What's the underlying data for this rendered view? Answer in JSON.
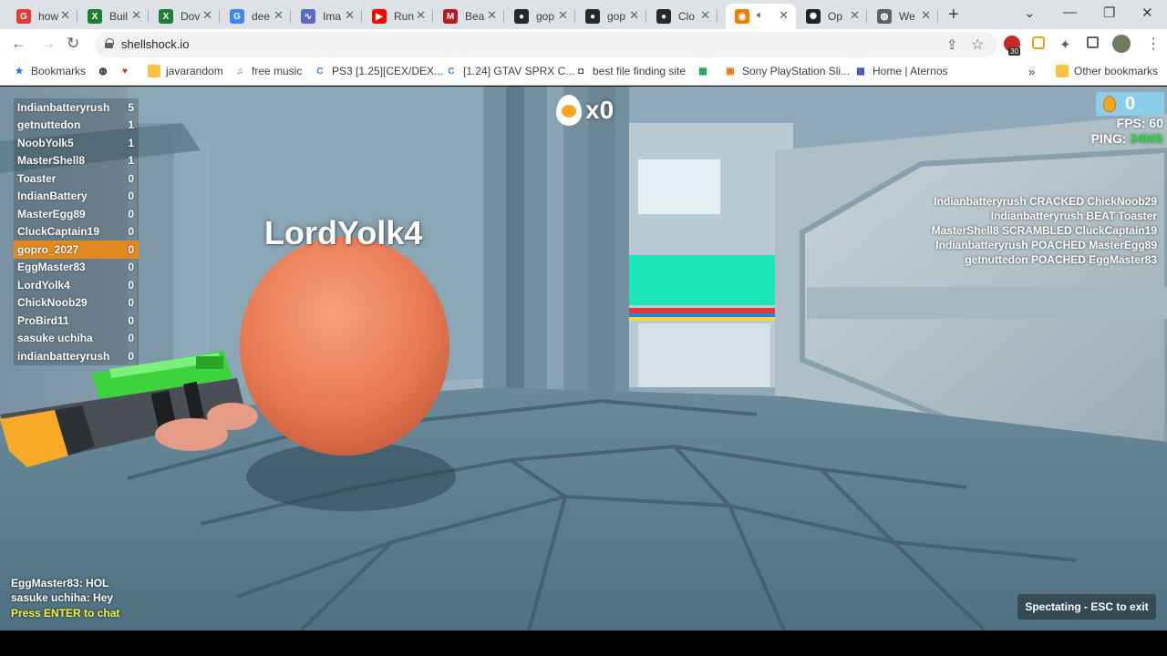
{
  "browser": {
    "tabs": [
      {
        "title": "how",
        "icon": "google-icon",
        "color": "#e53935"
      },
      {
        "title": "Buil",
        "icon": "excel-icon",
        "color": "#1e7e34"
      },
      {
        "title": "Dov",
        "icon": "excel-icon",
        "color": "#1e7e34"
      },
      {
        "title": "dee",
        "icon": "google-icon",
        "color": "#4285f4"
      },
      {
        "title": "Ima",
        "icon": "chart-icon",
        "color": "#5c6bc0"
      },
      {
        "title": "Run",
        "icon": "youtube-icon",
        "color": "#ff0000"
      },
      {
        "title": "Bea",
        "icon": "m-icon",
        "color": "#b71c1c"
      },
      {
        "title": "gop",
        "icon": "github-icon",
        "color": "#24292e"
      },
      {
        "title": "gop",
        "icon": "github-icon",
        "color": "#24292e"
      },
      {
        "title": "Clo",
        "icon": "github-icon",
        "color": "#24292e"
      },
      {
        "title": "",
        "icon": "shellshock-icon",
        "color": "#f57c00",
        "active": true
      },
      {
        "title": "Op",
        "icon": "openai-icon",
        "color": "#202124"
      },
      {
        "title": "We",
        "icon": "globe-icon",
        "color": "#5f6368"
      }
    ],
    "url": "shellshock.io",
    "extension_badge": "30"
  },
  "bookmarks": [
    {
      "label": "Bookmarks",
      "icon": "star-icon"
    },
    {
      "label": "",
      "icon": "globe-icon"
    },
    {
      "label": "",
      "icon": "heart-icon"
    },
    {
      "label": "javarandom",
      "icon": "folder-icon"
    },
    {
      "label": "free music",
      "icon": "music-icon"
    },
    {
      "label": "PS3 [1.25][CEX/DEX...",
      "icon": "c-icon"
    },
    {
      "label": "[1.24] GTAV SPRX C...",
      "icon": "c-icon"
    },
    {
      "label": "best file finding site",
      "icon": "robot-icon"
    },
    {
      "label": "",
      "icon": "sheet-icon"
    },
    {
      "label": "Sony PlayStation Sli...",
      "icon": "gift-icon"
    },
    {
      "label": "Home | Aternos",
      "icon": "aternos-icon"
    },
    {
      "label": "Other bookmarks",
      "icon": "folder-icon"
    }
  ],
  "game": {
    "scoreboard": [
      {
        "name": "Indianbatteryrush",
        "score": "5"
      },
      {
        "name": "getnuttedon",
        "score": "1"
      },
      {
        "name": "NoobYolk5",
        "score": "1"
      },
      {
        "name": "MasterShell8",
        "score": "1"
      },
      {
        "name": "Toaster",
        "score": "0"
      },
      {
        "name": "IndianBattery",
        "score": "0"
      },
      {
        "name": "MasterEgg89",
        "score": "0"
      },
      {
        "name": "CluckCaptain19",
        "score": "0"
      },
      {
        "name": "gopro_2027",
        "score": "0",
        "highlight": true
      },
      {
        "name": "EggMaster83",
        "score": "0"
      },
      {
        "name": "LordYolk4",
        "score": "0"
      },
      {
        "name": "ChickNoob29",
        "score": "0"
      },
      {
        "name": "ProBird11",
        "score": "0"
      },
      {
        "name": "sasuke uchiha",
        "score": "0"
      },
      {
        "name": "indianbatteryrush",
        "score": "0"
      }
    ],
    "kill_count": "x0",
    "eggs": "0",
    "fps_label": "FPS:",
    "fps_value": "60",
    "ping_label": "PING:",
    "ping_value": "34MS",
    "ping_color": "#29e03a",
    "killfeed": [
      "Indianbatteryrush CRACKED ChickNoob29",
      "Indianbatteryrush BEAT Toaster",
      "MasterShell8 SCRAMBLED CluckCaptain19",
      "Indianbatteryrush POACHED MasterEgg89",
      "getnuttedon POACHED EggMaster83"
    ],
    "player_nametag": "LordYolk4",
    "chat": [
      "EggMaster83: HOL",
      "sasuke uchiha: Hey"
    ],
    "chat_prompt": "Press ENTER to chat",
    "spectate_label": "Spectating - ESC to exit"
  }
}
